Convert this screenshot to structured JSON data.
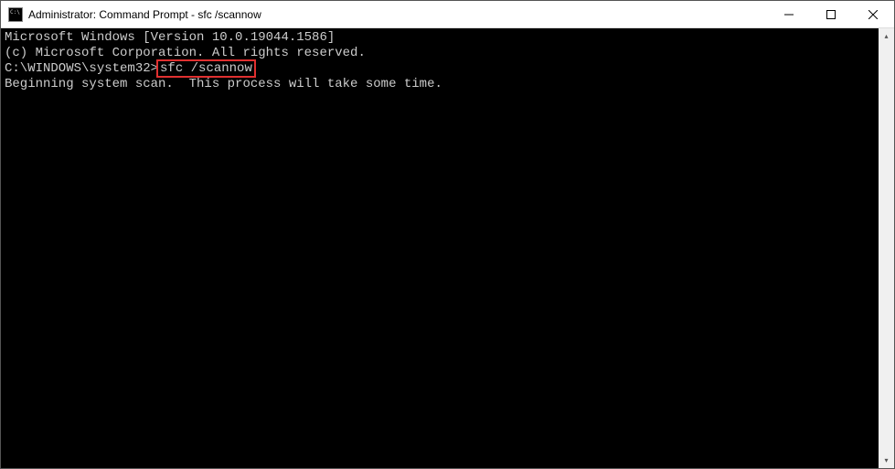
{
  "window": {
    "title": "Administrator: Command Prompt - sfc  /scannow"
  },
  "terminal": {
    "line1": "Microsoft Windows [Version 10.0.19044.1586]",
    "line2": "(c) Microsoft Corporation. All rights reserved.",
    "blank1": "",
    "prompt": "C:\\WINDOWS\\system32>",
    "command": "sfc /scannow",
    "blank2": "",
    "status": "Beginning system scan.  This process will take some time."
  },
  "controls": {
    "minimize": "—",
    "maximize": "☐",
    "close": "✕"
  },
  "scroll": {
    "up": "▴",
    "down": "▾"
  }
}
